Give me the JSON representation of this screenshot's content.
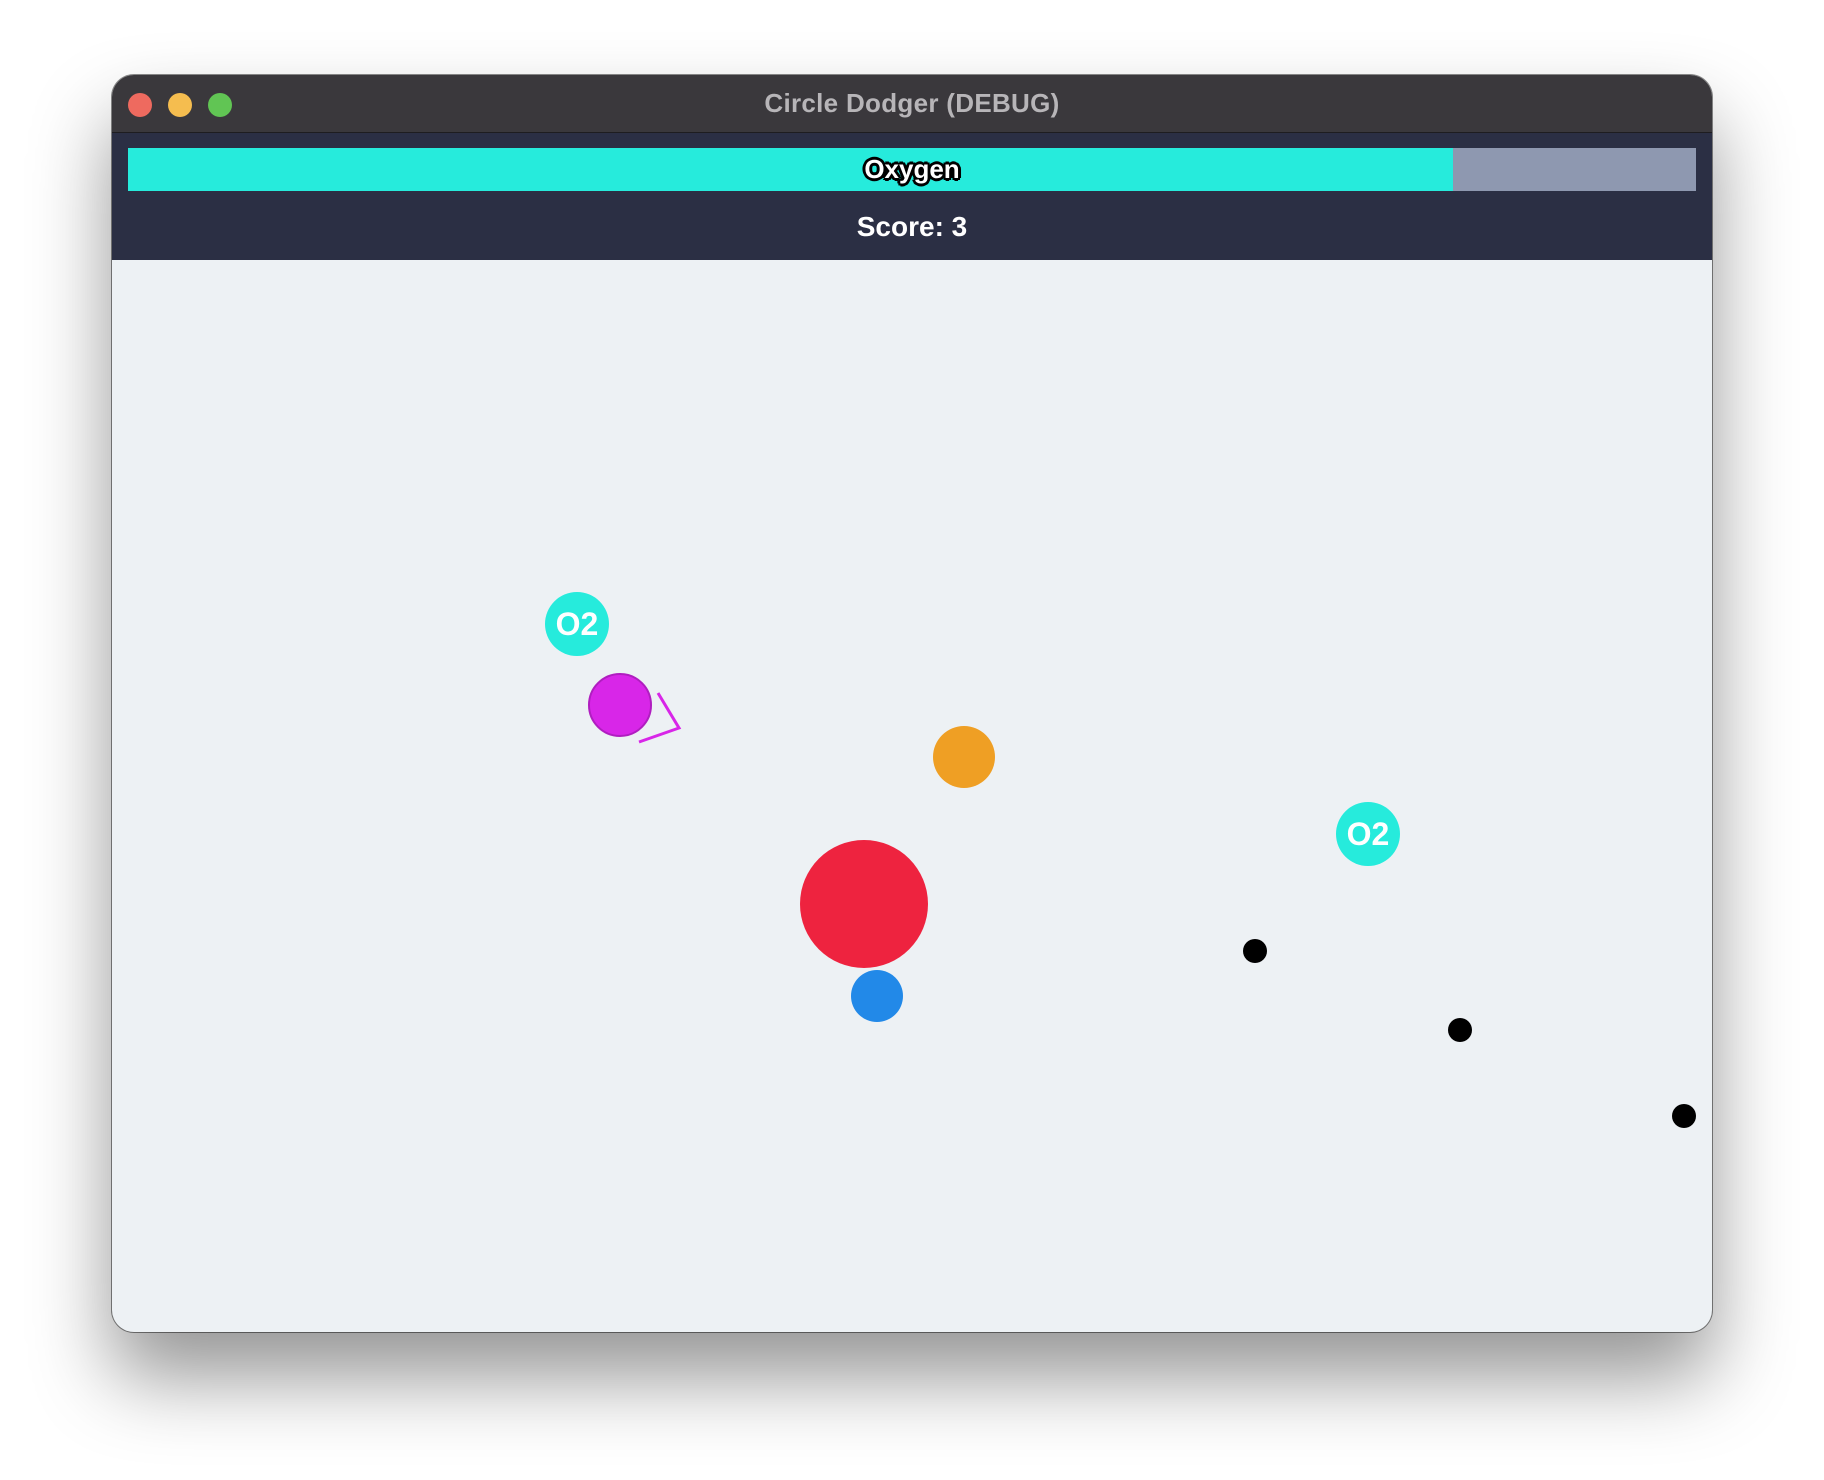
{
  "window": {
    "title": "Circle Dodger (DEBUG)"
  },
  "hud": {
    "oxygen_label": "Oxygen",
    "oxygen_level": 0.845,
    "score_text": "Score: 3"
  },
  "colors": {
    "oxygen_fill": "#26ebdc",
    "oxygen_empty": "#8e98b0",
    "hud_background": "#2b2f44",
    "playfield_background": "#edf1f4",
    "player": "#d826e8",
    "enemy_large": "#ee233f",
    "enemy_orange": "#ef9f24",
    "enemy_blue": "#2289e8",
    "projectile": "#000000",
    "o2_pickup": "#26ebdc"
  },
  "game": {
    "pickups": [
      {
        "label": "O2"
      },
      {
        "label": "O2"
      }
    ],
    "icons": {
      "player": "player-circle-icon",
      "direction": "aim-chevron-icon",
      "pickup": "o2-pickup-icon"
    }
  }
}
